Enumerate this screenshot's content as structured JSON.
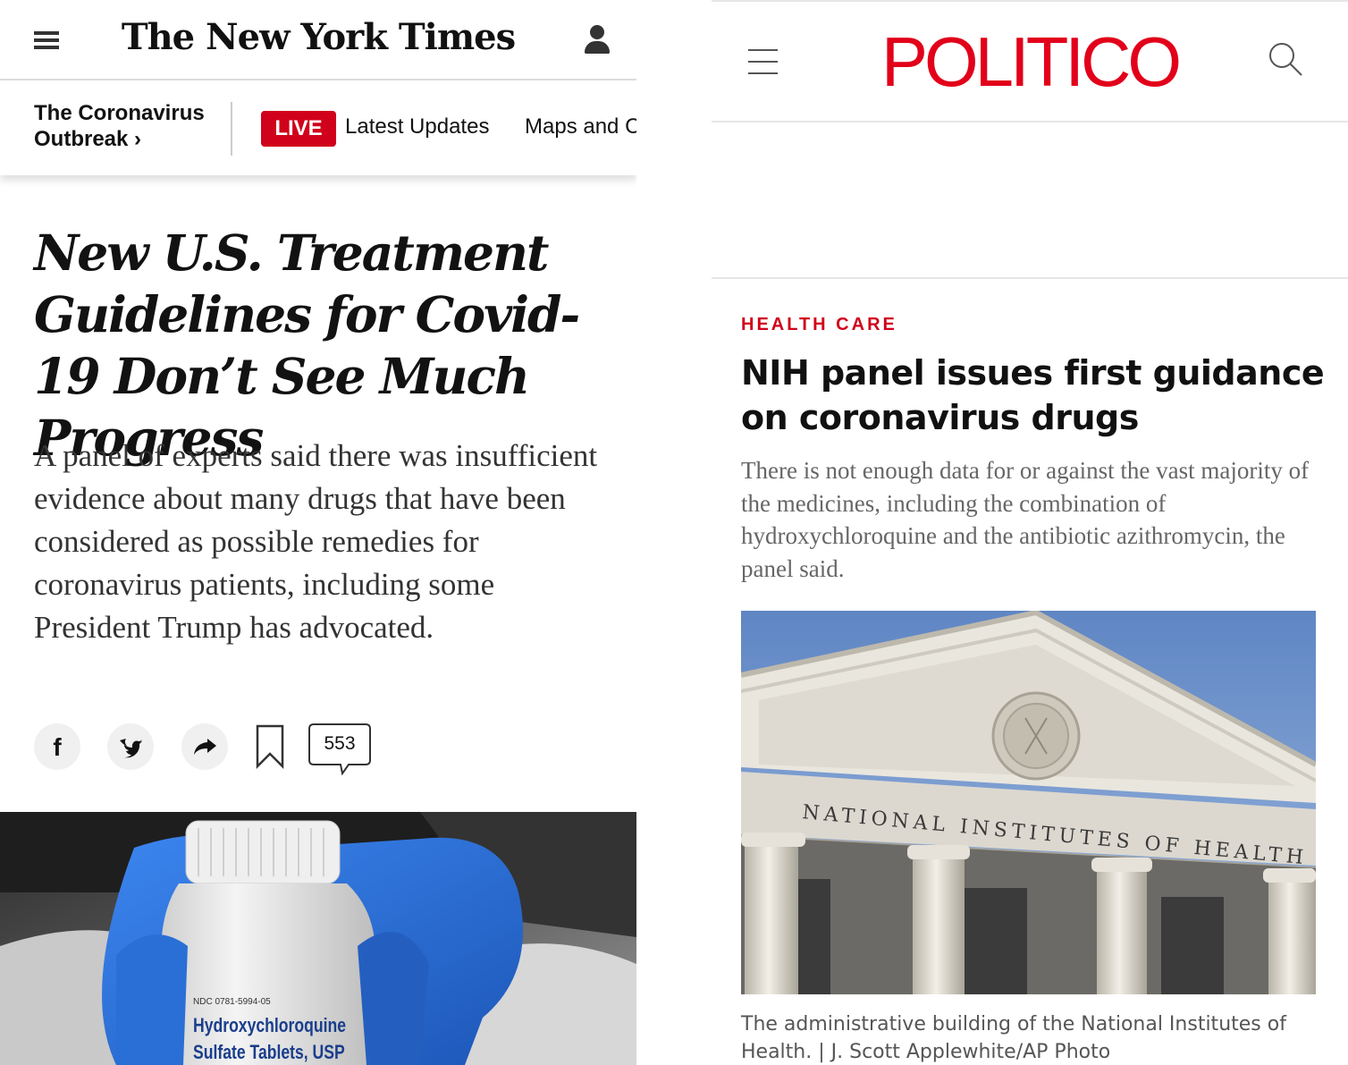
{
  "nyt": {
    "logo": "The New York Times",
    "menu_icon": "hamburger-icon",
    "user_icon": "user-icon",
    "section_label": "The Coronavirus Outbreak ›",
    "live_badge": "LIVE",
    "nav_items": [
      "Latest Updates",
      "Maps and C"
    ],
    "headline": "New U.S. Treatment Guidelines for Covid-19 Don’t See Much Progress",
    "summary": "A panel of experts said there was insufficient evidence about many drugs that have been considered as possible remedies for coronavirus patients, including some President Trump has advocated.",
    "share_icons": [
      "facebook-icon",
      "twitter-icon",
      "share-icon",
      "bookmark-icon"
    ],
    "comment_count": "553",
    "photo": {
      "ndc_text": "NDC 0781-5994-05",
      "label_line1": "Hydroxychloroquine",
      "label_line2": "Sulfate Tablets, USP"
    }
  },
  "politico": {
    "logo": "POLITICO",
    "menu_icon": "hamburger-icon",
    "search_icon": "search-icon",
    "kicker": "HEALTH CARE",
    "headline": "NIH panel issues first guidance on coronavirus drugs",
    "dek": "There is not enough data for or against the vast majority of the medicines, including the combination of hydroxychloroquine and the antibiotic azithromycin, the panel said.",
    "photo": {
      "building_text": "NATIONAL INSTITUTES OF HEALTH"
    },
    "caption": "The administrative building of the National Institutes of Health. | J. Scott Applewhite/AP Photo"
  },
  "colors": {
    "politico_red": "#e2001a",
    "nyt_live_red": "#d0021b",
    "glove_blue": "#2a6fd6"
  }
}
